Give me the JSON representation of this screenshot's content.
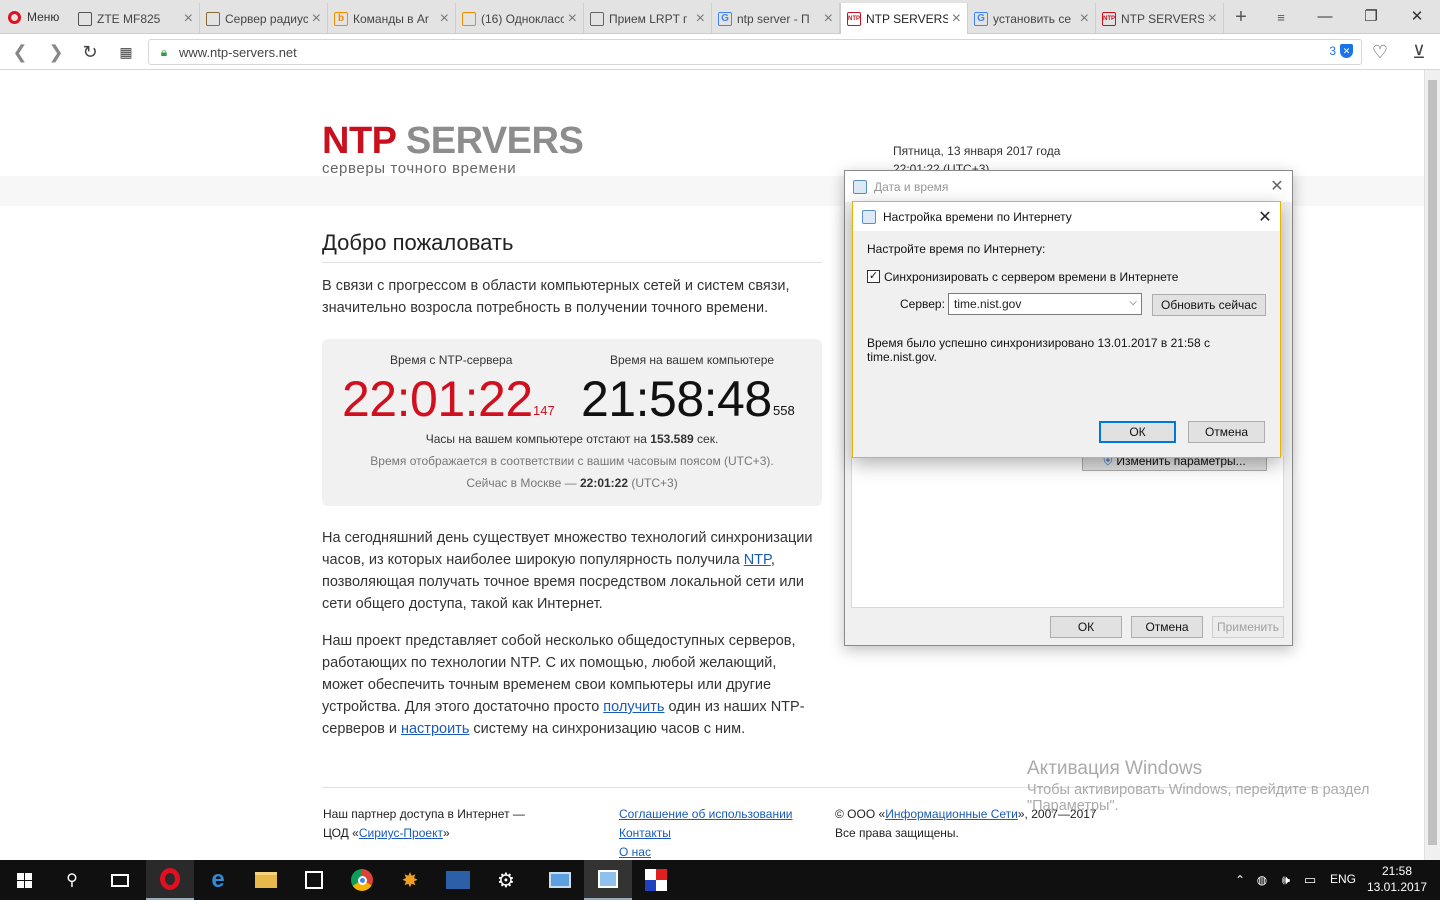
{
  "browser": {
    "menu_label": "Меню",
    "tabs": [
      {
        "title": "ZTE MF825",
        "fav_color": "#555555",
        "fav_text": ""
      },
      {
        "title": "Сервер радиус",
        "fav_color": "#8a6a30",
        "fav_text": ""
      },
      {
        "title": "Команды в Ar",
        "fav_color": "#f08c00",
        "fav_text": "b"
      },
      {
        "title": "(16) Однокласс",
        "fav_color": "#f08c00",
        "fav_text": ""
      },
      {
        "title": "Прием LRPT г",
        "fav_color": "#666666",
        "fav_text": ""
      },
      {
        "title": "ntp server - П",
        "fav_color": "#4285f4",
        "fav_text": "G"
      },
      {
        "title": "NTP SERVERS",
        "fav_color": "#c8101e",
        "fav_text": "NTP"
      },
      {
        "title": "установить се",
        "fav_color": "#4285f4",
        "fav_text": "G"
      },
      {
        "title": "NTP SERVERS",
        "fav_color": "#c8101e",
        "fav_text": "NTP"
      }
    ],
    "url": "www.ntp-servers.net",
    "adblock_count": "3"
  },
  "site": {
    "logo_ntp": "NTP",
    "logo_servers": "SERVERS",
    "logo_tagline": "серверы точного времени",
    "date": "Пятница, 13 января 2017 года",
    "time_header": "22:01:22 (UTC+3)",
    "welcome": "Добро пожаловать",
    "intro": "В связи с прогрессом в области компьютерных сетей и систем связи, значительно возросла потребность в получении точного времени.",
    "clock": {
      "ntp_label": "Время с NTP-сервера",
      "ntp_time": "22:01:22",
      "ntp_ms": "147",
      "pc_label": "Время на вашем компьютере",
      "pc_time": "21:58:48",
      "pc_ms": "558",
      "note1_pre": "Часы на вашем компьютере отстают на ",
      "note1_val": "153.589",
      "note1_post": " сек.",
      "note2": "Время отображается в соответствии с вашим часовым поясом (UTC+3).",
      "note3_pre": "Сейчас в Москве — ",
      "note3_val": "22:01:22",
      "note3_post": " (UTC+3)"
    },
    "p2_a": "На сегодняшний день существует множество технологий синхронизации часов, из которых наиболее широкую популярность получила ",
    "p2_link": "NTP",
    "p2_b": ", позволяющая получать точное время посредством локальной сети или сети общего доступа, такой как Интернет.",
    "p3_a": "Наш проект представляет собой несколько общедоступных серверов, работающих по технологии NTP. С их помощью, любой желающий, может обеспечить точным временем свои компьютеры или другие устройства. Для этого достаточно просто ",
    "p3_link1": "получить",
    "p3_b": " один из наших NTP-серверов и ",
    "p3_link2": "настроить",
    "p3_c": " систему на синхронизацию часов с ним.",
    "footer": {
      "partner_line1": "Наш партнер доступа в Интернет —",
      "partner_pre": "ЦОД «",
      "partner_link": "Сириус-Проект",
      "partner_post": "»",
      "link_terms": "Соглашение об использовании",
      "link_contacts": "Контакты",
      "link_about": "О нас",
      "copy_pre": "© ООО «",
      "copy_link": "Информационные Сети",
      "copy_post": "», 2007—2017",
      "rights": "Все права защищены."
    }
  },
  "dialog_outer": {
    "title": "Дата и время",
    "change_btn": "Изменить параметры...",
    "ok": "ОК",
    "cancel": "Отмена",
    "apply": "Применить"
  },
  "dialog_inner": {
    "title": "Настройка времени по Интернету",
    "heading": "Настройте время по Интернету:",
    "sync_label": "Синхронизировать с сервером времени в Интернете",
    "sync_checked": "✓",
    "server_label": "Сервер:",
    "server_value": "time.nist.gov",
    "update_btn": "Обновить сейчас",
    "status": "Время было успешно синхронизировано 13.01.2017 в 21:58 с time.nist.gov.",
    "ok": "ОК",
    "cancel": "Отмена"
  },
  "activation": {
    "title": "Активация Windows",
    "text": "Чтобы активировать Windows, перейдите в раздел \"Параметры\"."
  },
  "taskbar": {
    "lang": "ENG",
    "clock_time": "21:58",
    "clock_date": "13.01.2017"
  }
}
